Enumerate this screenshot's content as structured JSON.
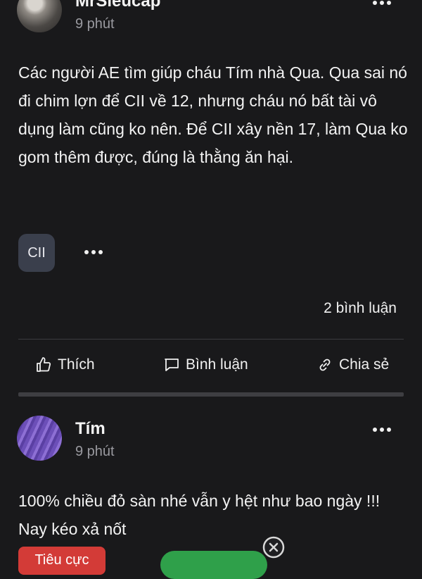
{
  "post1": {
    "author": "MrSieucap",
    "time": "9 phút",
    "text": "Các người AE tìm giúp cháu Tím nhà Qua. Qua sai nó đi chim lợn để CII về 12, nhưng cháu nó bất tài vô dụng làm cũng ko nên. Để CII xây nền 17, làm Qua ko gom thêm được, đúng là thằng ăn hại.",
    "tag": "CII",
    "comments": "2 bình luận"
  },
  "actions": {
    "like": "Thích",
    "comment": "Bình luận",
    "share": "Chia sẻ"
  },
  "post2": {
    "author": "Tím",
    "time": "9 phút",
    "text": "100% chiều đỏ sàn nhé vẫn y hệt như bao ngày !!! Nay kéo xả nốt",
    "badge": "Tiêu cực"
  },
  "colors": {
    "background": "#19191b",
    "tag_bg": "#3a3f4c",
    "negative_badge": "#d33b37",
    "green_button": "#2fa04a"
  },
  "icons": [
    "more-icon",
    "thumbs-up-icon",
    "chat-bubble-icon",
    "link-icon",
    "close-icon"
  ]
}
